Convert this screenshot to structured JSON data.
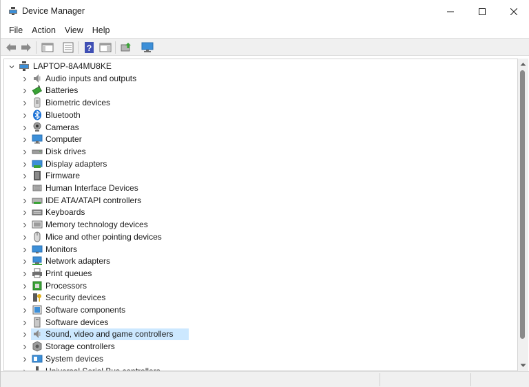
{
  "window": {
    "title": "Device Manager",
    "controls": {
      "minimize_icon": "minimize-icon",
      "maximize_icon": "maximize-icon",
      "close_icon": "close-icon"
    }
  },
  "menu": {
    "items": [
      "File",
      "Action",
      "View",
      "Help"
    ]
  },
  "toolbar": {
    "buttons": [
      "back-arrow-icon",
      "forward-arrow-icon",
      "show-hide-console-tree-icon",
      "properties-icon",
      "help-icon",
      "action-pane-icon",
      "update-driver-icon",
      "scan-hardware-icon"
    ]
  },
  "tree": {
    "root": "LAPTOP-8A4MU8KE",
    "selected_index": 21,
    "items": [
      {
        "label": "Audio inputs and outputs",
        "icon": "speaker-icon"
      },
      {
        "label": "Batteries",
        "icon": "battery-icon"
      },
      {
        "label": "Biometric devices",
        "icon": "biometric-icon"
      },
      {
        "label": "Bluetooth",
        "icon": "bluetooth-icon"
      },
      {
        "label": "Cameras",
        "icon": "camera-icon"
      },
      {
        "label": "Computer",
        "icon": "computer-icon"
      },
      {
        "label": "Disk drives",
        "icon": "disk-drive-icon"
      },
      {
        "label": "Display adapters",
        "icon": "display-adapter-icon"
      },
      {
        "label": "Firmware",
        "icon": "firmware-icon"
      },
      {
        "label": "Human Interface Devices",
        "icon": "hid-icon"
      },
      {
        "label": "IDE ATA/ATAPI controllers",
        "icon": "ide-controller-icon"
      },
      {
        "label": "Keyboards",
        "icon": "keyboard-icon"
      },
      {
        "label": "Memory technology devices",
        "icon": "memory-icon"
      },
      {
        "label": "Mice and other pointing devices",
        "icon": "mouse-icon"
      },
      {
        "label": "Monitors",
        "icon": "monitor-icon"
      },
      {
        "label": "Network adapters",
        "icon": "network-adapter-icon"
      },
      {
        "label": "Print queues",
        "icon": "printer-icon"
      },
      {
        "label": "Processors",
        "icon": "processor-icon"
      },
      {
        "label": "Security devices",
        "icon": "security-device-icon"
      },
      {
        "label": "Software components",
        "icon": "software-component-icon"
      },
      {
        "label": "Software devices",
        "icon": "software-device-icon"
      },
      {
        "label": "Sound, video and game controllers",
        "icon": "speaker-icon"
      },
      {
        "label": "Storage controllers",
        "icon": "storage-controller-icon"
      },
      {
        "label": "System devices",
        "icon": "system-device-icon"
      },
      {
        "label": "Universal Serial Bus controllers",
        "icon": "usb-icon"
      }
    ]
  },
  "colors": {
    "selection": "#cce8ff",
    "accent": "#0078d4"
  }
}
